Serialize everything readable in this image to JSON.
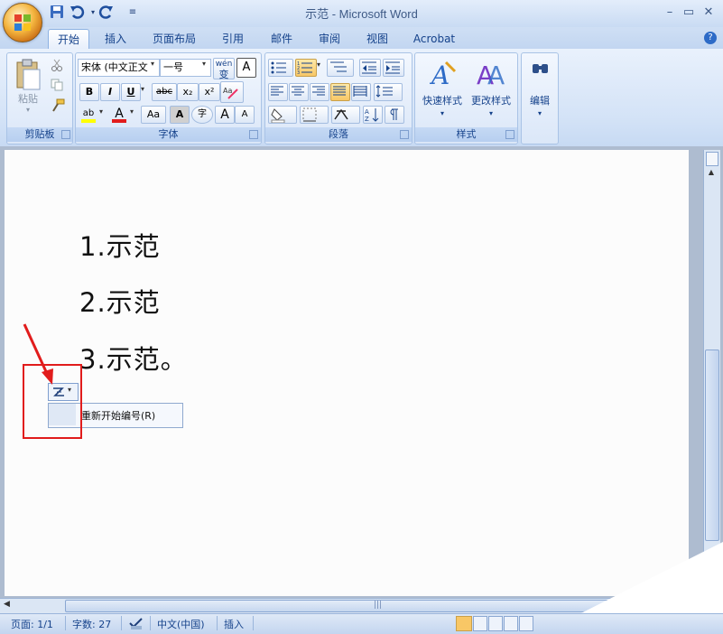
{
  "window": {
    "title": "示范 - Microsoft Word",
    "controls": [
      "minimize-icon",
      "maximize-icon",
      "close-icon"
    ]
  },
  "quick_access": [
    "save-icon",
    "undo-icon",
    "redo-icon",
    "customize-icon"
  ],
  "tabs": [
    {
      "label": "开始",
      "active": true
    },
    {
      "label": "插入"
    },
    {
      "label": "页面布局"
    },
    {
      "label": "引用"
    },
    {
      "label": "邮件"
    },
    {
      "label": "审阅"
    },
    {
      "label": "视图"
    },
    {
      "label": "Acrobat"
    }
  ],
  "help_label": "?",
  "ribbon": {
    "clipboard": {
      "label": "剪贴板",
      "paste_label": "粘贴"
    },
    "font": {
      "label": "字体",
      "font_name": "宋体 (中文正文",
      "font_size": "一号",
      "phonetic": "wén",
      "bold": "B",
      "italic": "I",
      "underline": "U",
      "strike": "abc",
      "subscript": "x₂",
      "superscript": "x²",
      "case": "Aa",
      "char_border": "A",
      "enclosed": "字",
      "grow": "A",
      "shrink": "A",
      "font_color": "A",
      "highlight": "ab"
    },
    "paragraph": {
      "label": "段落"
    },
    "styles": {
      "label": "样式",
      "quick_styles": "快速样式",
      "change_styles": "更改样式"
    },
    "editing": {
      "label": "编辑"
    }
  },
  "document": {
    "lines": [
      "1.示范",
      "2.示范",
      "3.示范。"
    ]
  },
  "autocorrect": {
    "menu_item": "重新开始编号(R)"
  },
  "statusbar": {
    "page": "页面: 1/1",
    "words": "字数: 27",
    "language": "中文(中国)",
    "mode": "插入"
  },
  "colors": {
    "ribbon_text": "#15428b",
    "annotation_red": "#e11c1c",
    "highlight_yellow": "#f8c766"
  }
}
